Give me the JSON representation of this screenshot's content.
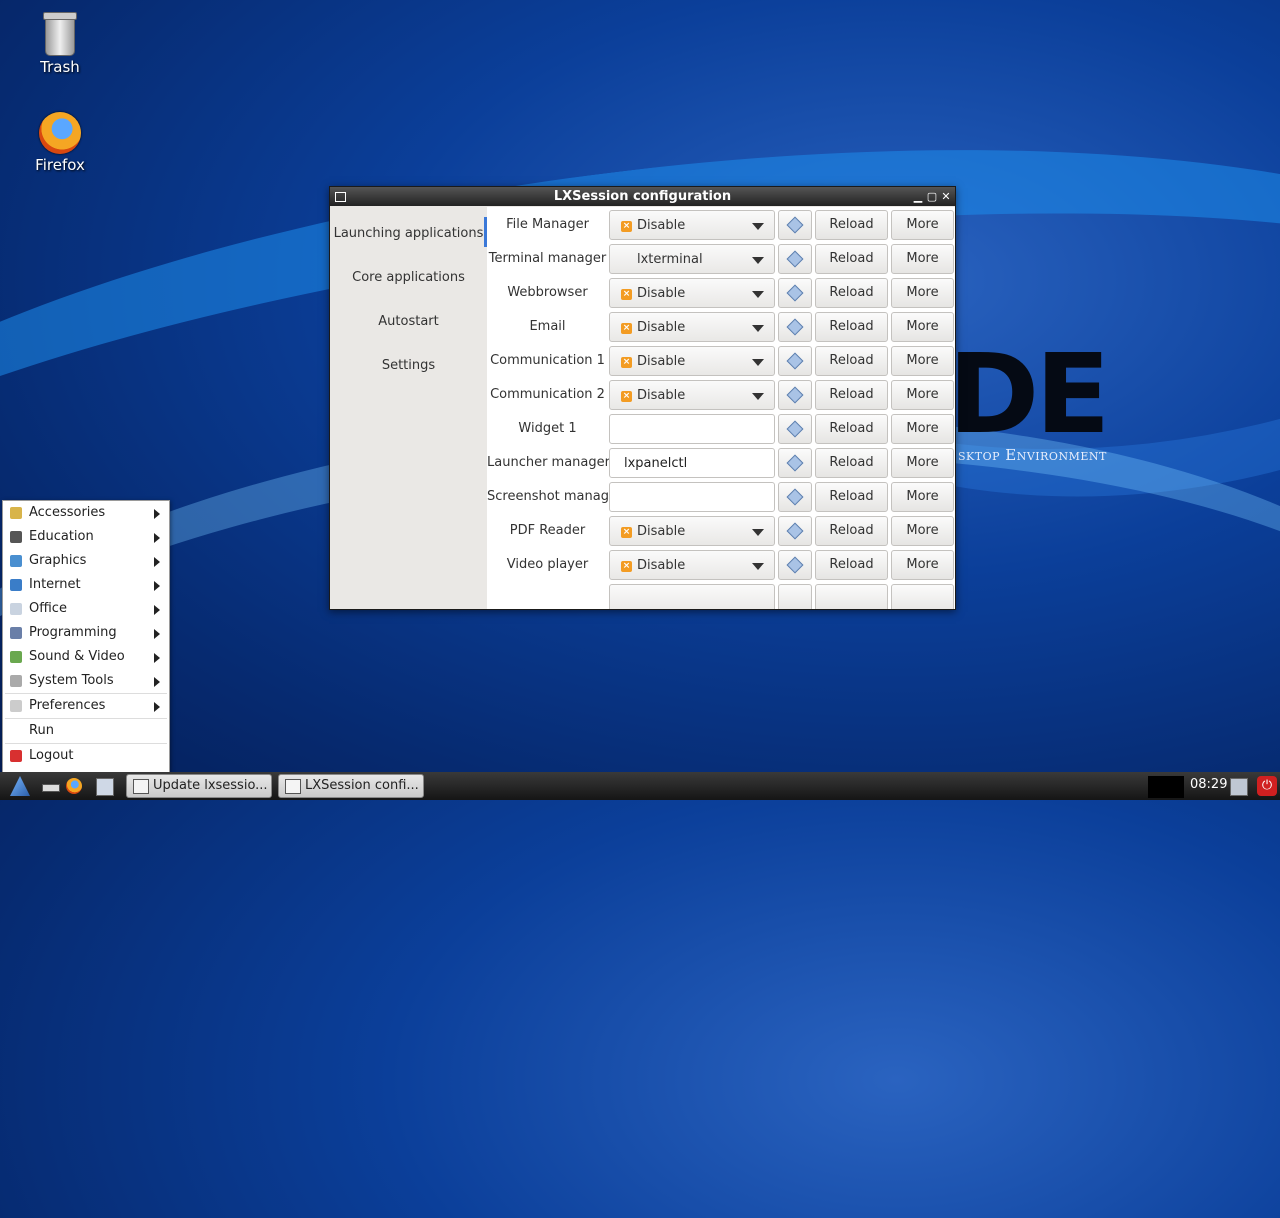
{
  "desktop": {
    "icons": [
      {
        "label": "Trash"
      },
      {
        "label": "Firefox"
      }
    ],
    "wallpaper_text": {
      "logo": "DE",
      "tagline": "sktop Environment"
    }
  },
  "window": {
    "title": "LXSession configuration",
    "controls": {
      "minimize": "▁",
      "maximize": "▢",
      "close": "✕"
    },
    "sidebar": [
      {
        "label": "Launching applications",
        "active": true
      },
      {
        "label": "Core applications"
      },
      {
        "label": "Autostart"
      },
      {
        "label": "Settings"
      }
    ],
    "buttons": {
      "reload": "Reload",
      "more": "More"
    },
    "rows": [
      {
        "label": "File Manager",
        "kind": "combo",
        "value": "Disable",
        "icon": true
      },
      {
        "label": "Terminal manager",
        "kind": "combo",
        "value": "lxterminal",
        "icon": false
      },
      {
        "label": "Webbrowser",
        "kind": "combo",
        "value": "Disable",
        "icon": true
      },
      {
        "label": "Email",
        "kind": "combo",
        "value": "Disable",
        "icon": true
      },
      {
        "label": "Communication 1",
        "kind": "combo",
        "value": "Disable",
        "icon": true
      },
      {
        "label": "Communication 2",
        "kind": "combo",
        "value": "Disable",
        "icon": true
      },
      {
        "label": "Widget 1",
        "kind": "entry",
        "value": ""
      },
      {
        "label": "Launcher manager",
        "kind": "entry",
        "value": "lxpanelctl"
      },
      {
        "label": "Screenshot manager",
        "kind": "entry",
        "value": ""
      },
      {
        "label": "PDF Reader",
        "kind": "combo",
        "value": "Disable",
        "icon": true
      },
      {
        "label": "Video player",
        "kind": "combo",
        "value": "Disable",
        "icon": true
      }
    ]
  },
  "menu": {
    "items": [
      {
        "label": "Accessories",
        "icon": "accessories-icon",
        "color": "#d8b44a",
        "submenu": true
      },
      {
        "label": "Education",
        "icon": "flask-icon",
        "color": "#555555",
        "submenu": true
      },
      {
        "label": "Graphics",
        "icon": "graphics-icon",
        "color": "#4a8fd0",
        "submenu": true
      },
      {
        "label": "Internet",
        "icon": "globe-icon",
        "color": "#3a7dc8",
        "submenu": true
      },
      {
        "label": "Office",
        "icon": "office-icon",
        "color": "#c9d3e0",
        "submenu": true
      },
      {
        "label": "Programming",
        "icon": "programming-icon",
        "color": "#6a7fa8",
        "submenu": true
      },
      {
        "label": "Sound & Video",
        "icon": "music-icon",
        "color": "#6aa84f",
        "submenu": true
      },
      {
        "label": "System Tools",
        "icon": "system-tools-icon",
        "color": "#aaaaaa",
        "submenu": true
      },
      {
        "label": "Preferences",
        "icon": "preferences-icon",
        "color": "#cccccc",
        "submenu": true
      },
      {
        "label": "Run",
        "icon": "",
        "color": "",
        "submenu": false
      },
      {
        "label": "Logout",
        "icon": "logout-icon",
        "color": "#d83030",
        "submenu": false
      }
    ]
  },
  "taskbar": {
    "tasks": [
      {
        "label": "Update lxsessio..."
      },
      {
        "label": "LXSession confi..."
      }
    ],
    "clock": "08:29"
  }
}
